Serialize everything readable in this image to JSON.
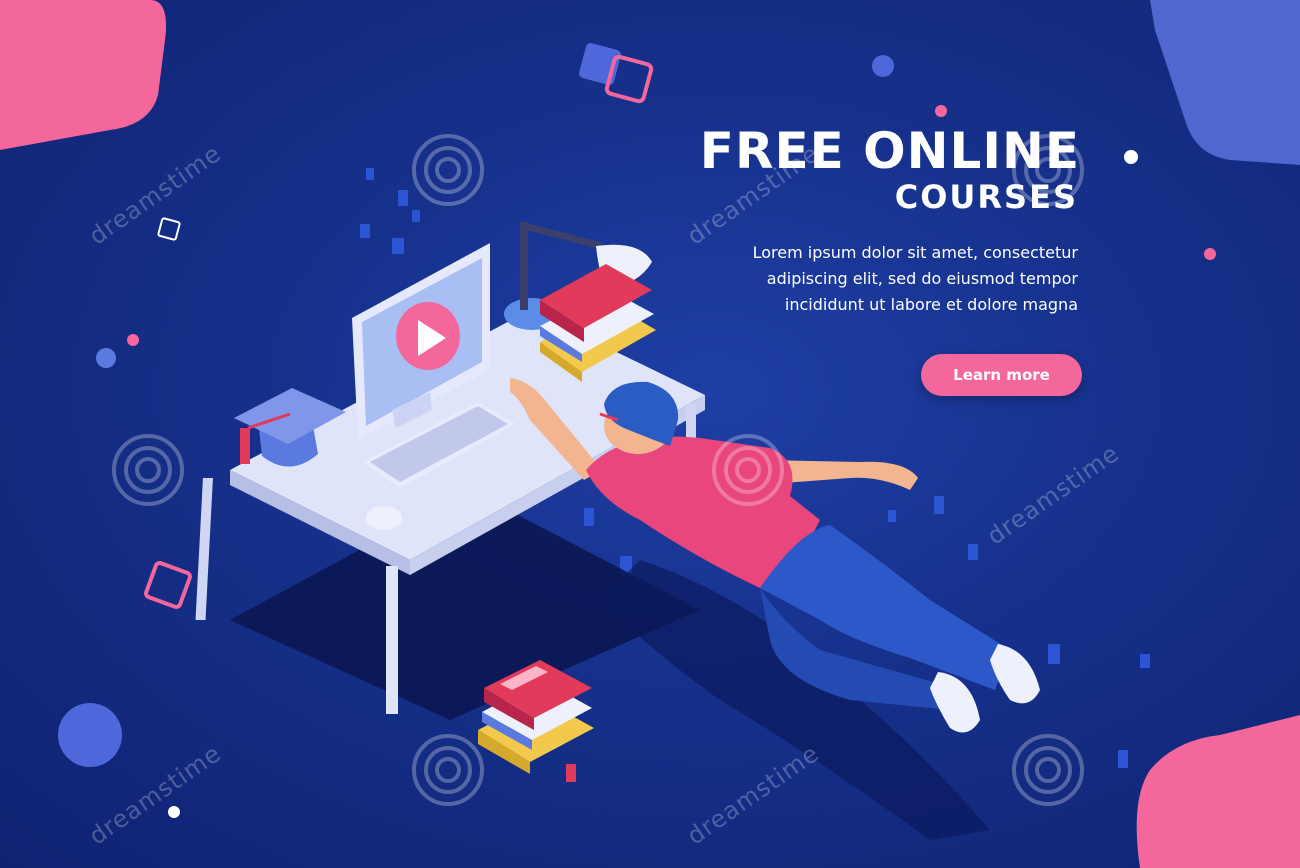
{
  "hero": {
    "title": "FREE ONLINE",
    "subtitle": "COURSES",
    "body_lines": [
      "Lorem ipsum dolor sit amet, consectetur",
      "adipiscing elit, sed do eiusmod tempor",
      "incididunt ut labore et dolore magna"
    ],
    "cta_label": "Learn more"
  },
  "watermark": {
    "brand": "dreamstime"
  },
  "colors": {
    "background": "#16308a",
    "accent_pink": "#f4679d",
    "accent_lavender": "#5b6fd6",
    "text": "#ffffff"
  },
  "icons": [
    "play-icon",
    "graduation-cap-icon",
    "desk-lamp-icon",
    "book-stack-icon",
    "watermark-spiral-icon"
  ]
}
